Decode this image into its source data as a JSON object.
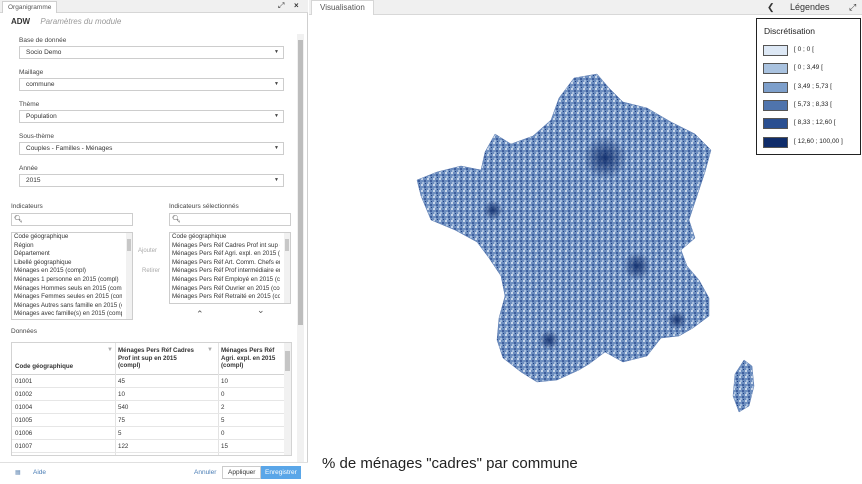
{
  "left_panel": {
    "window_tab": "Organigramme",
    "app_name": "ADW",
    "module_title": "Paramètres du module",
    "fields": [
      {
        "label": "Base de donnée",
        "value": "Socio Demo"
      },
      {
        "label": "Maillage",
        "value": "commune"
      },
      {
        "label": "Thème",
        "value": "Population"
      },
      {
        "label": "Sous-thème",
        "value": "Couples - Familles - Ménages"
      },
      {
        "label": "Année",
        "value": "2015"
      }
    ],
    "indicators": {
      "label": "Indicateurs",
      "items": [
        "Code géographique",
        "Région",
        "Département",
        "Libellé géographique",
        "Ménages en 2015 (compl)",
        "Ménages 1 personne en 2015 (compl)",
        "Ménages Hommes seuls en 2015 (compl)",
        "Ménages Femmes seules en 2015 (compl)",
        "Ménages Autres sans famille en 2015 (co",
        "Ménages avec famille(s) en 2015 (compl)"
      ]
    },
    "selected": {
      "label": "Indicateurs sélectionnés",
      "items": [
        "Code géographique",
        "Ménages Pers Réf Cadres Prof int sup en 2",
        "Ménages Pers Réf Agri. expl. en 2015 (co",
        "Ménages Pers Réf Art. Comm. Chefs entr.",
        "Ménages Pers Réf Prof intermédiaire en 2",
        "Ménages Pers Réf Employé en 2015 (comp",
        "Ménages Pers Réf Ouvrier en 2015 (comp",
        "Ménages Pers Réf Retraité en 2015 (comp"
      ]
    },
    "add_label": "Ajouter",
    "remove_label": "Retirer",
    "move_up": "⌃",
    "move_down": "⌄",
    "donnees_label": "Données",
    "grid": {
      "headers": [
        "Code géographique",
        "Ménages Pers Réf Cadres Prof int sup en 2015 (compl)",
        "Ménages Pers Réf Agri. expl. en 2015 (compl)"
      ],
      "rows": [
        [
          "01001",
          "45",
          "10"
        ],
        [
          "01002",
          "10",
          "0"
        ],
        [
          "01004",
          "540",
          "2"
        ],
        [
          "01005",
          "75",
          "5"
        ],
        [
          "01006",
          "5",
          "0"
        ],
        [
          "01007",
          "122",
          "15"
        ]
      ]
    },
    "footer": {
      "aide": "Aide",
      "annuler": "Annuler",
      "appliquer": "Appliquer",
      "enregistrer": "Enregistrer"
    }
  },
  "right_panel": {
    "tab": "Visualisation",
    "legendes": "Légendes",
    "legend": {
      "title": "Discrétisation",
      "classes": [
        {
          "label": "[ 0 ; 0 [",
          "color": "#dde8f5"
        },
        {
          "label": "[ 0 ; 3,49 [",
          "color": "#a9c2df"
        },
        {
          "label": "[ 3,49 ; 5,73 [",
          "color": "#7d9fcb"
        },
        {
          "label": "[ 5,73 ; 8,33 [",
          "color": "#4f74ad"
        },
        {
          "label": "[ 8,33 ; 12,60 [",
          "color": "#2a4f91"
        },
        {
          "label": "[ 12,60 ; 100,00 ]",
          "color": "#0f2c6a"
        }
      ]
    },
    "caption": "% de ménages \"cadres\" par commune"
  }
}
